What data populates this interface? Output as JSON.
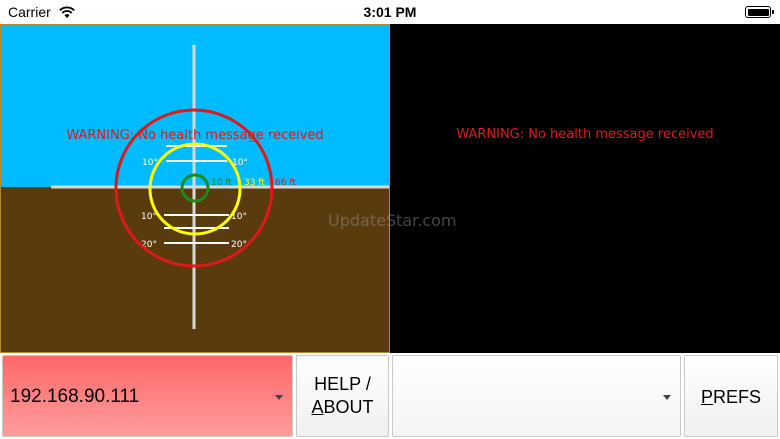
{
  "status_bar": {
    "carrier": "Carrier",
    "time": "3:01 PM"
  },
  "attitude_indicator": {
    "sky_color": "#00bbff",
    "ground_color": "#5a3b0d",
    "warning": "WARNING: No health message received",
    "pitch_ladder": {
      "upper_left": "10°",
      "upper_right": "10°",
      "lower_left_1": "10°",
      "lower_right_1": "10°",
      "lower_left_2": "20°",
      "lower_right_2": "20°"
    },
    "range_labels": {
      "inner": "10 ft",
      "middle": "33 ft",
      "outer": "66 ft"
    },
    "ring_colors": {
      "inner": "#1a8a1a",
      "middle": "#ffff00",
      "outer": "#e01818"
    }
  },
  "secondary_display": {
    "background": "#000000",
    "warning": "WARNING: No health message received"
  },
  "watermark": "UpdateStar.com",
  "controls": {
    "ip_address": "192.168.90.111",
    "help_line1": "HELP /",
    "help_line2_first": "A",
    "help_line2_rest": "BOUT",
    "selector_value": "",
    "prefs_first": "P",
    "prefs_rest": "REFS"
  }
}
